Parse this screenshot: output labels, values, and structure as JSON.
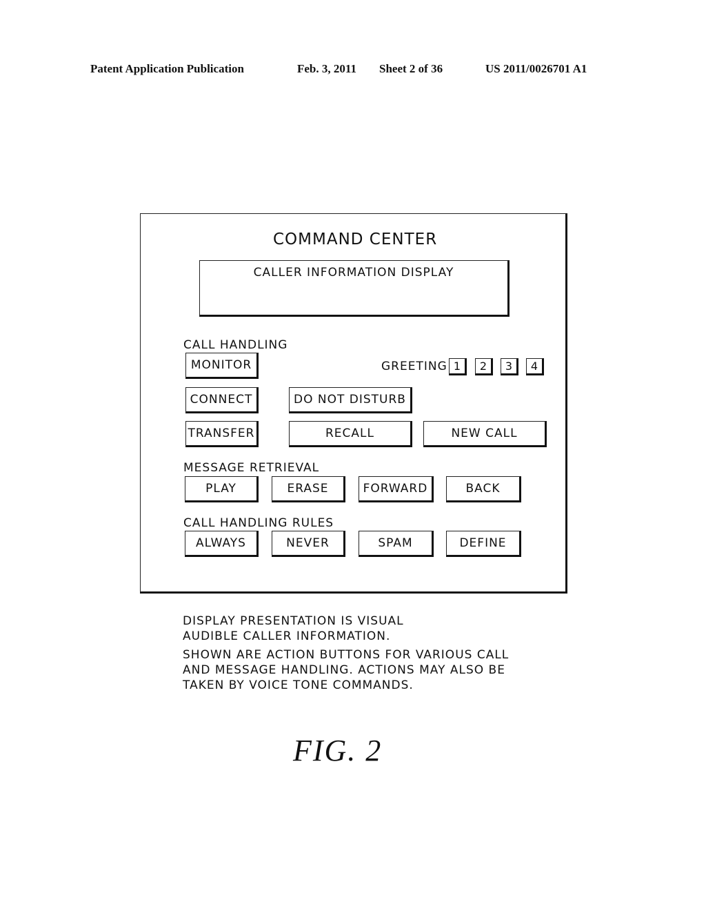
{
  "header": {
    "publication": "Patent Application Publication",
    "date": "Feb. 3, 2011",
    "sheet": "Sheet 2 of 36",
    "number": "US 2011/0026701 A1"
  },
  "panel": {
    "title": "COMMAND CENTER",
    "display_label": "CALLER INFORMATION DISPLAY",
    "call_handling": {
      "label": "CALL HANDLING",
      "monitor": "MONITOR",
      "connect": "CONNECT",
      "transfer": "TRANSFER",
      "do_not_disturb": "DO NOT DISTURB",
      "recall": "RECALL",
      "new_call": "NEW CALL",
      "greeting_label": "GREETING",
      "greetings": [
        "1",
        "2",
        "3",
        "4"
      ]
    },
    "message_retrieval": {
      "label": "MESSAGE RETRIEVAL",
      "buttons": [
        "PLAY",
        "ERASE",
        "FORWARD",
        "BACK"
      ]
    },
    "call_handling_rules": {
      "label": "CALL HANDLING RULES",
      "buttons": [
        "ALWAYS",
        "NEVER",
        "SPAM",
        "DEFINE"
      ]
    }
  },
  "caption": {
    "line1": "DISPLAY PRESENTATION IS VISUAL",
    "line2": "AUDIBLE CALLER INFORMATION.",
    "line3": "SHOWN ARE ACTION BUTTONS FOR VARIOUS CALL",
    "line4": "AND MESSAGE HANDLING. ACTIONS MAY ALSO BE",
    "line5": "TAKEN BY VOICE TONE COMMANDS."
  },
  "figure_label": "FIG. 2"
}
